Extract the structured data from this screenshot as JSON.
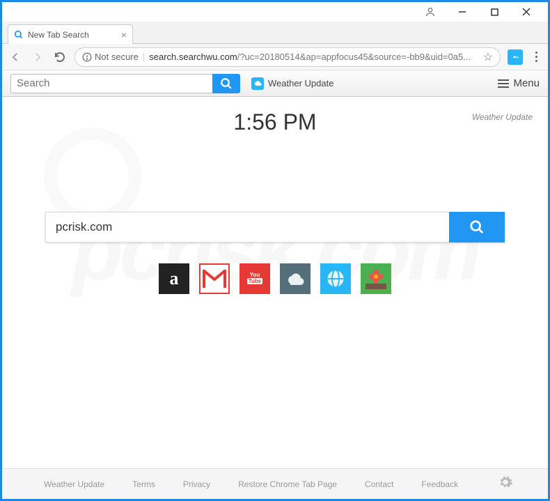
{
  "window": {
    "tab_title": "New Tab Search"
  },
  "address": {
    "not_secure": "Not secure",
    "domain": "search.searchwu.com",
    "path": "/?uc=20180514&ap=appfocus45&source=-bb9&uid=0a5..."
  },
  "toolbar": {
    "search_placeholder": "Search",
    "weather_label": "Weather Update",
    "menu_label": "Menu"
  },
  "content": {
    "time": "1:56 PM",
    "weather_link": "Weather Update",
    "main_search_value": "pcrisk.com"
  },
  "shortcuts": {
    "amazon": "a",
    "youtube": "You Tube"
  },
  "footer": {
    "weather": "Weather Update",
    "terms": "Terms",
    "privacy": "Privacy",
    "restore": "Restore Chrome Tab Page",
    "contact": "Contact",
    "feedback": "Feedback"
  }
}
